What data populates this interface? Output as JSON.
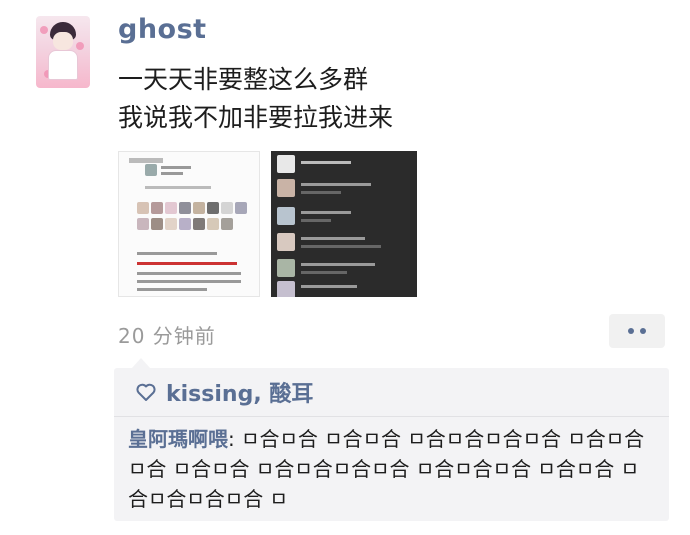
{
  "post": {
    "username": "ghost",
    "text_line1": "一天天非要整这么多群",
    "text_line2": "我说我不加非要拉我进来",
    "time": "20 分钟前",
    "more_icon": "ellipsis-icon"
  },
  "likes": {
    "icon": "heart-icon",
    "names": "kissing, 酸耳"
  },
  "comment": {
    "author": "皇阿瑪啊喂",
    "text": ": ㅁ合ㅁ合 ㅁ合ㅁ合 ㅁ合ㅁ合ㅁ合ㅁ合 ㅁ合ㅁ合ㅁ合 ㅁ合ㅁ合 ㅁ合ㅁ合ㅁ合ㅁ合 ㅁ合ㅁ合ㅁ合 ㅁ合ㅁ合 ㅁ合ㅁ合ㅁ合ㅁ合 ㅁ"
  }
}
